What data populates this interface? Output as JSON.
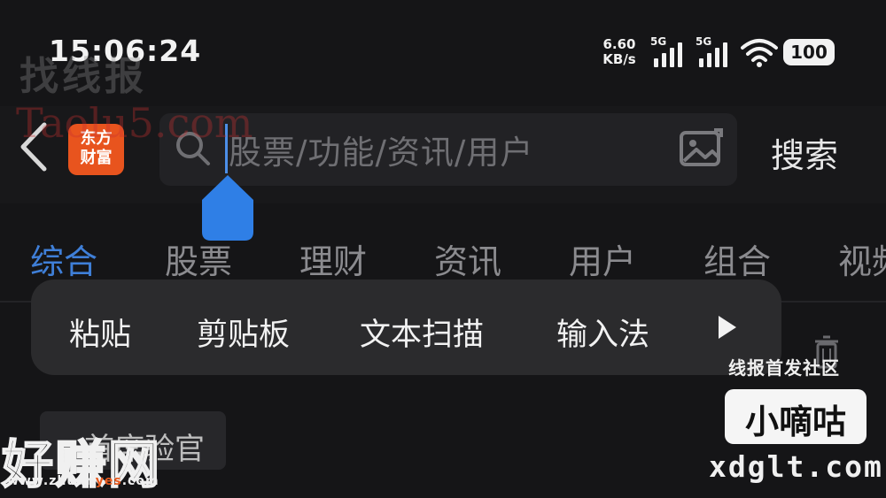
{
  "status_bar": {
    "time": "15:06:24",
    "net_speed_value": "6.60",
    "net_speed_unit": "KB/s",
    "signal_1_label": "5G",
    "signal_2_label": "5G",
    "battery": "100"
  },
  "header": {
    "logo_line1": "东方",
    "logo_line2": "财富",
    "search_placeholder": "股票/功能/资讯/用户",
    "search_button": "搜索"
  },
  "tabs": [
    {
      "label": "综合",
      "active": true
    },
    {
      "label": "股票",
      "active": false
    },
    {
      "label": "理财",
      "active": false
    },
    {
      "label": "资讯",
      "active": false
    },
    {
      "label": "用户",
      "active": false
    },
    {
      "label": "组合",
      "active": false
    },
    {
      "label": "视频",
      "active": false
    }
  ],
  "context_menu": {
    "items": [
      "粘贴",
      "剪贴板",
      "文本扫描",
      "输入法"
    ]
  },
  "history": {
    "chip_label": "首席验官"
  },
  "watermarks": {
    "wm1": "找线报",
    "wm2": "Taolu5.com",
    "wm3_top": "线报首发社区",
    "wm3_main": "小嘀咕",
    "wm3_url": "xdglt.com",
    "wm4_main": "好赚网",
    "wm4_url_pre": "www.zhuan",
    "wm4_url_hl": "yes",
    "wm4_url_post": ".com"
  },
  "colors": {
    "background": "#151517",
    "accent_tab": "#3f7fd8",
    "cursor": "#4c8fe8",
    "logo": "#e8541e"
  }
}
